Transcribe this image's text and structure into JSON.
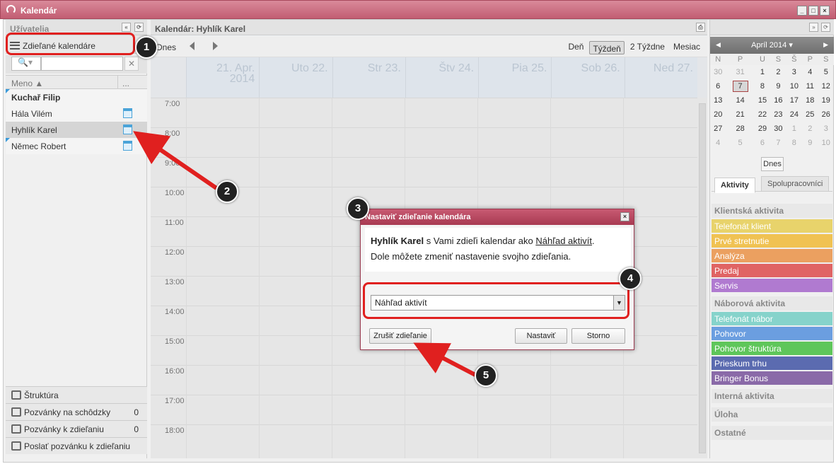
{
  "window": {
    "title": "Kalendár"
  },
  "left": {
    "header": "Užívatelia",
    "shared_label": "Zdieľané kalendáre",
    "col_name": "Meno ▲",
    "col_more": "...",
    "users": [
      {
        "name": "Kuchař Filip",
        "bold": true
      },
      {
        "name": "Hála Vilém"
      },
      {
        "name": "Hyhlík Karel"
      },
      {
        "name": "Němec Robert"
      }
    ],
    "bottom": [
      {
        "label": "Štruktúra",
        "count": ""
      },
      {
        "label": "Pozvánky na schôdzky",
        "count": "0"
      },
      {
        "label": "Pozvánky k zdieľaniu",
        "count": "0"
      },
      {
        "label": "Poslať pozvánku k zdieľaniu",
        "count": ""
      }
    ]
  },
  "center": {
    "header": "Kalendár: Hyhlík Karel",
    "today": "Dnes",
    "views": [
      "Deň",
      "Týždeň",
      "2 Týždne",
      "Mesiac"
    ],
    "days": [
      "21. Apr. 2014",
      "Uto 22.",
      "Str 23.",
      "Štv 24.",
      "Pia 25.",
      "Sob 26.",
      "Ned 27."
    ],
    "hours": [
      "7:00",
      "8:00",
      "9:00",
      "10:00",
      "11:00",
      "12:00",
      "13:00",
      "14:00",
      "15:00",
      "16:00",
      "17:00",
      "18:00"
    ]
  },
  "right": {
    "month": "Apríl 2014 ▾",
    "weekdays": [
      "N",
      "P",
      "U",
      "S",
      "Š",
      "P",
      "S"
    ],
    "weeks": [
      [
        "30",
        "31",
        "1",
        "2",
        "3",
        "4",
        "5"
      ],
      [
        "6",
        "7",
        "8",
        "9",
        "10",
        "11",
        "12"
      ],
      [
        "13",
        "14",
        "15",
        "16",
        "17",
        "18",
        "19"
      ],
      [
        "20",
        "21",
        "22",
        "23",
        "24",
        "25",
        "26"
      ],
      [
        "27",
        "28",
        "29",
        "30",
        "1",
        "2",
        "3"
      ],
      [
        "4",
        "5",
        "6",
        "7",
        "8",
        "9",
        "10"
      ]
    ],
    "today_btn": "Dnes",
    "tabs": [
      "Aktivity",
      "Spolupracovníci"
    ],
    "categories": [
      {
        "title": "Klientská aktivita",
        "items": [
          {
            "label": "Telefonát klient",
            "color": "#e8d36b"
          },
          {
            "label": "Prvé stretnutie",
            "color": "#f0c253"
          },
          {
            "label": "Analýza",
            "color": "#eba060"
          },
          {
            "label": "Predaj",
            "color": "#e06464"
          },
          {
            "label": "Servis",
            "color": "#b07ad0"
          }
        ]
      },
      {
        "title": "Náborová aktivita",
        "items": [
          {
            "label": "Telefonát nábor",
            "color": "#86d3cb"
          },
          {
            "label": "Pohovor",
            "color": "#6b9ee0"
          },
          {
            "label": "Pohovor štruktúra",
            "color": "#5ec65a"
          },
          {
            "label": "Prieskum trhu",
            "color": "#5b6bb0"
          },
          {
            "label": "Bringer Bonus",
            "color": "#8a6aa8"
          }
        ]
      },
      {
        "title": "Interná aktivita",
        "items": []
      },
      {
        "title": "Úloha",
        "items": []
      },
      {
        "title": "Ostatné",
        "items": []
      }
    ]
  },
  "dialog": {
    "title": "Nastaviť zdieľanie kalendára",
    "user": "Hyhlík Karel",
    "text1": " s Vami zdieľi kalendar ako ",
    "link": "Náhľad aktivít",
    "text2": ".",
    "text3": "Dole môžete zmeniť nastavenie svojho zdieľania.",
    "select_value": "Náhľad aktivít",
    "btn_cancel_share": "Zrušiť zdieľanie",
    "btn_set": "Nastaviť",
    "btn_storno": "Storno"
  },
  "callouts": [
    "1",
    "2",
    "3",
    "4",
    "5"
  ]
}
